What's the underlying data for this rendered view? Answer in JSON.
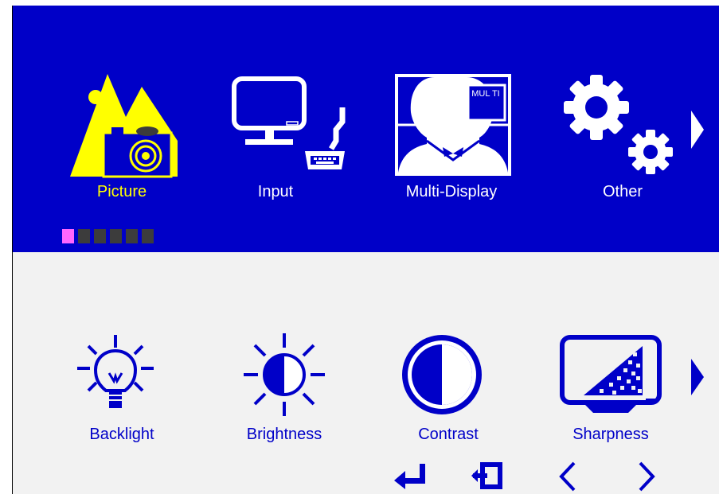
{
  "top_menu": {
    "items": [
      {
        "label": "Picture",
        "icon": "picture-icon",
        "selected": true
      },
      {
        "label": "Input",
        "icon": "input-icon",
        "selected": false
      },
      {
        "label": "Multi-Display",
        "icon": "multi-display-icon",
        "selected": false,
        "badge": "MUL TI"
      },
      {
        "label": "Other",
        "icon": "gear-icon",
        "selected": false
      }
    ],
    "page_dots": {
      "count": 6,
      "active_index": 0
    },
    "next_icon": "chevron-right-icon"
  },
  "sub_menu": {
    "items": [
      {
        "label": "Backlight",
        "icon": "backlight-icon"
      },
      {
        "label": "Brightness",
        "icon": "brightness-icon"
      },
      {
        "label": "Contrast",
        "icon": "contrast-icon"
      },
      {
        "label": "Sharpness",
        "icon": "sharpness-icon"
      }
    ],
    "next_icon": "chevron-right-icon"
  },
  "nav_buttons": [
    "enter-icon",
    "exit-icon",
    "chevron-left-icon",
    "chevron-right-icon"
  ],
  "colors": {
    "top_bg": "#0000c8",
    "bottom_bg": "#f2f2f2",
    "selected_text": "#ffff00",
    "normal_text": "#ffffff",
    "icon_blue": "#0000c8",
    "dot_active": "#ff66ff",
    "dot_inactive": "#3c3c3c"
  }
}
